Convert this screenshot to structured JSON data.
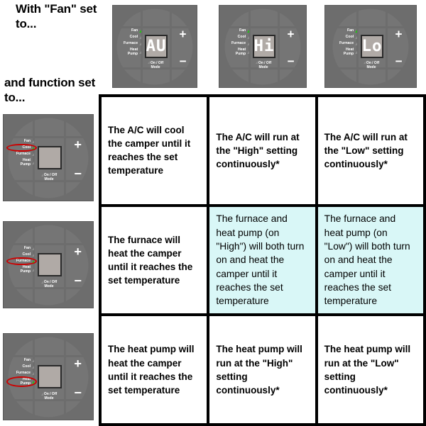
{
  "headings": {
    "fan": "With \"Fan\" set to...",
    "function": "and function set to..."
  },
  "colors": {
    "panel_body": "#6d6d6d",
    "dial": "#757575",
    "lcd": "#b0aaa6",
    "led_on": "#22c215",
    "led_off": "#8d8d8d",
    "highlight_cell": "#d9f7f7",
    "ring": "#cc0000",
    "grid_line": "#000000"
  },
  "column_thermostats": [
    {
      "id": "fan-auto",
      "display": "AU",
      "labels": [
        {
          "text": "Fan",
          "led": "on"
        },
        {
          "text": "Cool",
          "led": "off"
        },
        {
          "text": "Furnace",
          "led": "off"
        },
        {
          "text": "Heat Pump",
          "led": "off"
        }
      ],
      "plus": "+",
      "minus": "−",
      "onoff": "On / Off Mode",
      "circled": null
    },
    {
      "id": "fan-high",
      "display": "Hi",
      "labels": [
        {
          "text": "Fan",
          "led": "on"
        },
        {
          "text": "Cool",
          "led": "off"
        },
        {
          "text": "Furnace",
          "led": "off"
        },
        {
          "text": "Heat Pump",
          "led": "off"
        }
      ],
      "plus": "+",
      "minus": "−",
      "onoff": "On / Off Mode",
      "circled": null
    },
    {
      "id": "fan-low",
      "display": "Lo",
      "labels": [
        {
          "text": "Fan",
          "led": "on"
        },
        {
          "text": "Cool",
          "led": "off"
        },
        {
          "text": "Furnace",
          "led": "off"
        },
        {
          "text": "Heat Pump",
          "led": "off"
        }
      ],
      "plus": "+",
      "minus": "−",
      "onoff": "On / Off Mode",
      "circled": null
    }
  ],
  "row_thermostats": [
    {
      "id": "function-cool",
      "display": "",
      "labels": [
        {
          "text": "Fan",
          "led": "off"
        },
        {
          "text": "Cool",
          "led": "on"
        },
        {
          "text": "Furnace",
          "led": "off"
        },
        {
          "text": "Heat Pump",
          "led": "off"
        }
      ],
      "plus": "+",
      "minus": "−",
      "onoff": "On / Off Mode",
      "circled": "Cool"
    },
    {
      "id": "function-furnace",
      "display": "",
      "labels": [
        {
          "text": "Fan",
          "led": "off"
        },
        {
          "text": "Cool",
          "led": "off"
        },
        {
          "text": "Furnace",
          "led": "on"
        },
        {
          "text": "Heat Pump",
          "led": "off"
        }
      ],
      "plus": "+",
      "minus": "−",
      "onoff": "On / Off Mode",
      "circled": "Furnace"
    },
    {
      "id": "function-heatpump",
      "display": "",
      "labels": [
        {
          "text": "Fan",
          "led": "off"
        },
        {
          "text": "Cool",
          "led": "off"
        },
        {
          "text": "Furnace",
          "led": "off"
        },
        {
          "text": "Heat Pump",
          "led": "on"
        }
      ],
      "plus": "+",
      "minus": "−",
      "onoff": "On / Off Mode",
      "circled": "Heat Pump"
    }
  ],
  "matrix": {
    "r0c0": "The A/C will cool the camper until it reaches the set temperature",
    "r0c1": "The A/C will run at the \"High\" setting continuously*",
    "r0c2": "The A/C will run at the \"Low\" setting continuously*",
    "r1c0": "The furnace will heat the camper until it reaches the set temperature",
    "r1c1": "The furnace and heat pump (on \"High\") will both turn on and heat the camper until it reaches the set temperature",
    "r1c2": "The furnace and heat pump (on \"Low\") will both turn on and heat the camper until it reaches the set temperature",
    "r2c0": "The heat pump will heat the camper until it reaches the set temperature",
    "r2c1": "The heat pump will run at the \"High\" setting continuously*",
    "r2c2": "The heat pump will run at the \"Low\" setting continuously*"
  },
  "highlighted_cells": [
    "r1c1",
    "r1c2"
  ]
}
